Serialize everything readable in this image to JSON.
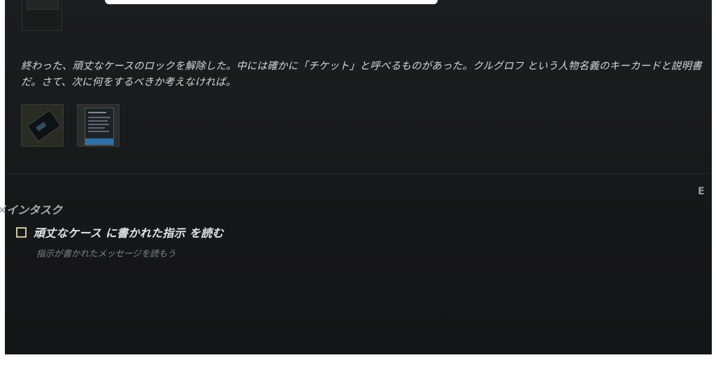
{
  "story": {
    "message": "終わった、頑丈なケースのロックを解除した。中には確かに「チケット」と呼べるものがあった。クルグロフ という人物名義のキーカードと説明書だ。さて、次に何をするべきか考えなければ。",
    "attachments": [
      {
        "icon": "keycard-thumbnail"
      },
      {
        "icon": "manual-thumbnail"
      }
    ]
  },
  "edge_glyph": "E",
  "tasks": {
    "section_title": "メインタスク",
    "items": [
      {
        "title": "頑丈なケース に書かれた指示 を読む",
        "description": "指示が書かれたメッセージを読もう",
        "completed": false
      }
    ]
  },
  "colors": {
    "background": "#151617",
    "text": "#d6d6d6",
    "checkbox_border": "#d2c79d",
    "muted": "#808183"
  }
}
